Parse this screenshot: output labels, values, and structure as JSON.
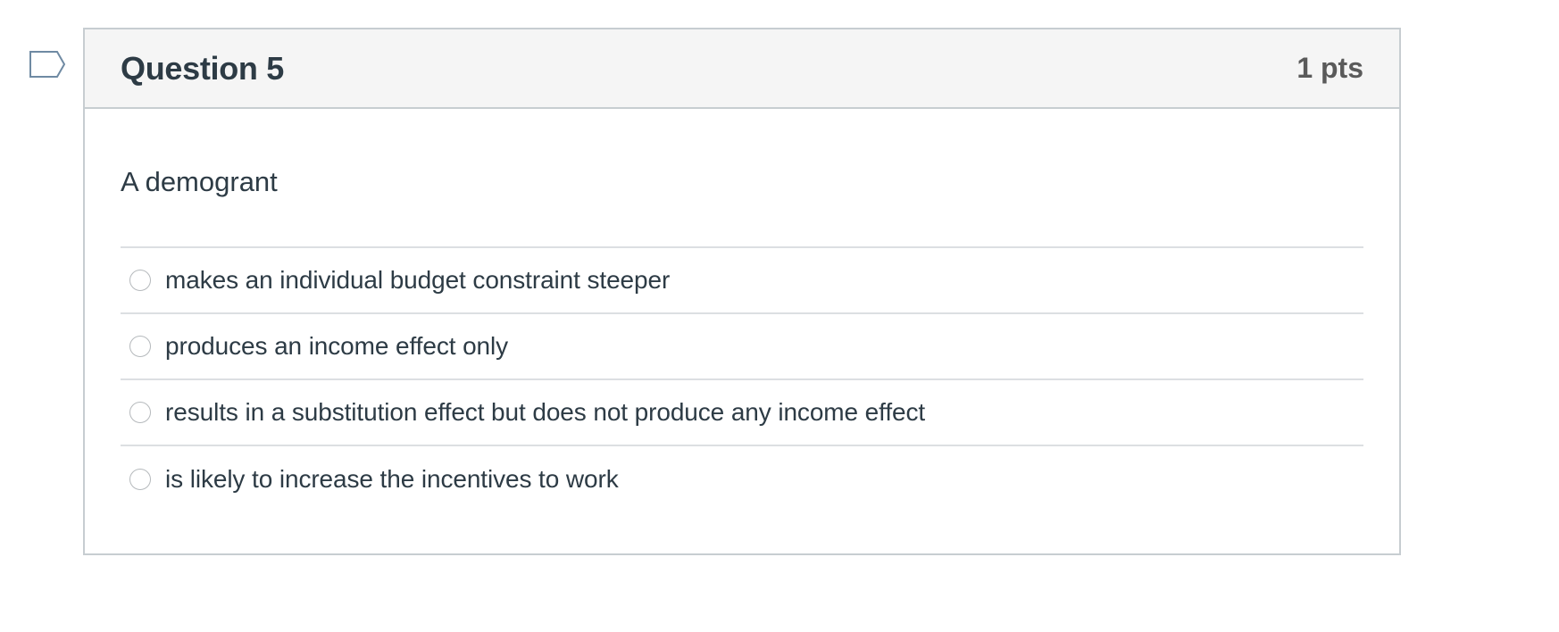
{
  "question": {
    "title": "Question 5",
    "points": "1 pts",
    "text": "A demogrant",
    "answers": [
      {
        "label": "makes an individual budget constraint steeper"
      },
      {
        "label": "produces an income effect only"
      },
      {
        "label": "results in a substitution effect but does not produce any income effect"
      },
      {
        "label": "is likely to increase the incentives to work"
      }
    ]
  },
  "icons": {
    "flag": "flag-question-icon"
  },
  "colors": {
    "text": "#2d3b45",
    "header_bg": "#f5f5f5",
    "border": "#c7cdd1",
    "points_text": "#5a5a5a"
  }
}
